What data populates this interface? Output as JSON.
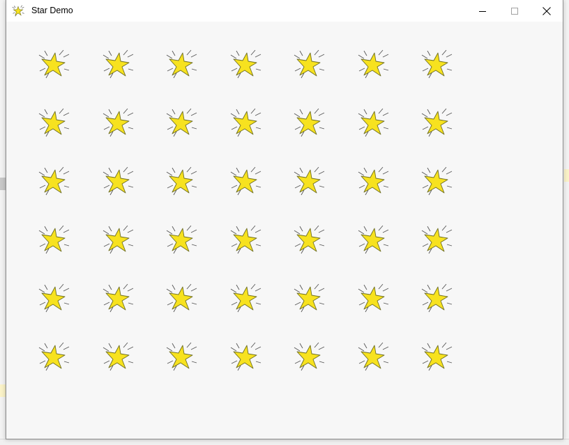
{
  "window": {
    "title": "Star Demo",
    "minimize_icon": "minimize-icon",
    "maximize_icon": "maximize-icon",
    "close_icon": "close-icon",
    "app_icon": "star-icon"
  },
  "grid": {
    "rows": 6,
    "columns": 7
  },
  "colors": {
    "star_fill": "#f7e21f",
    "star_stroke": "#6e6e22",
    "ray_stroke": "#555555",
    "client_background": "#f7f7f7"
  }
}
